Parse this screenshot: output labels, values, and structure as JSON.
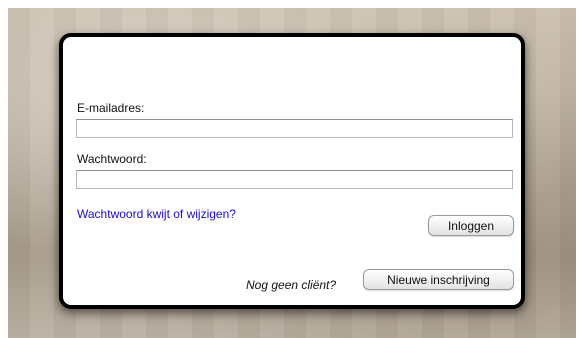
{
  "login_dialog": {
    "email_label": "E-mailadres:",
    "email_value": "",
    "password_label": "Wachtwoord:",
    "password_value": "",
    "forgot_link": "Wachtwoord kwijt of wijzigen?",
    "login_button": "Inloggen",
    "no_client_text": "Nog geen cliënt?",
    "register_button": "Nieuwe inschrijving"
  },
  "colors": {
    "link": "#1a0dcc",
    "dialog_border": "#000000",
    "dialog_background": "#ffffff"
  }
}
